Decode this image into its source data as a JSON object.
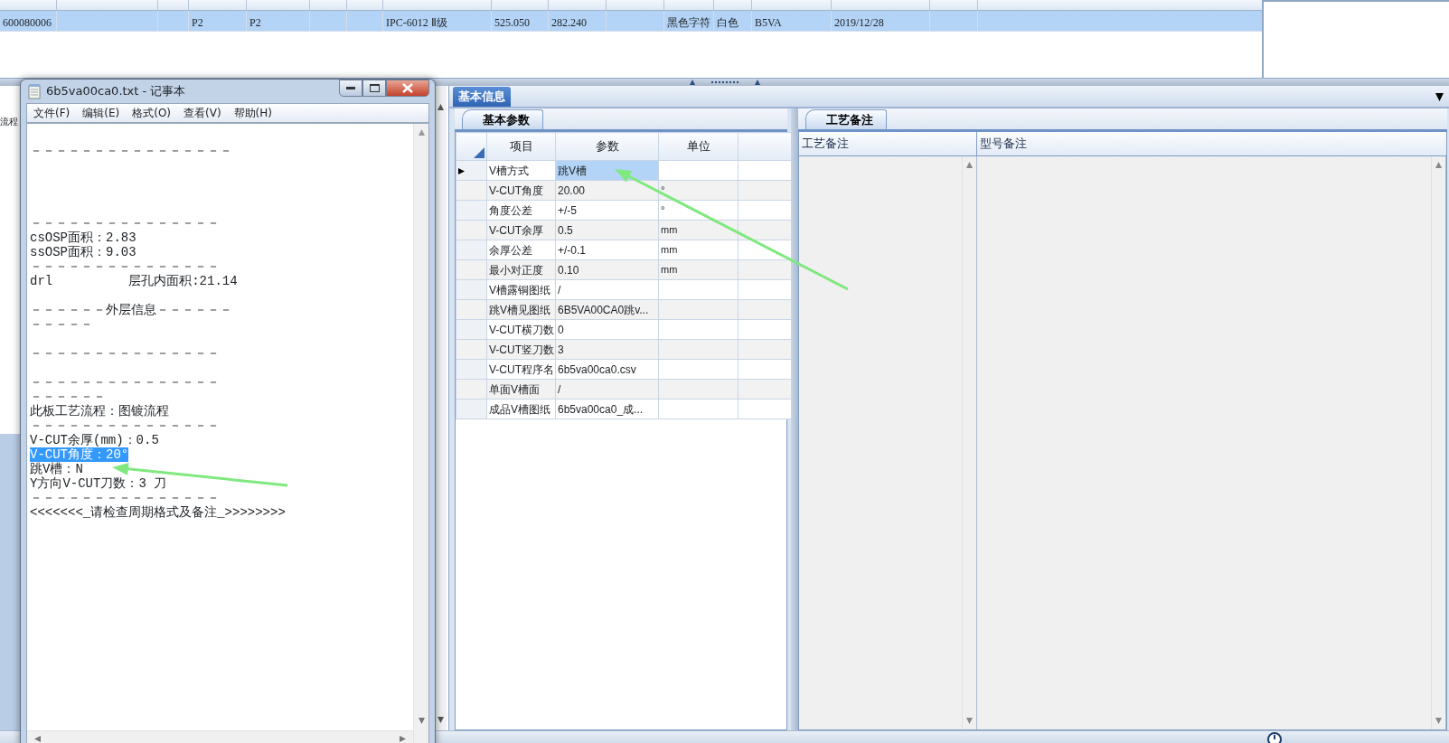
{
  "top_grid": {
    "rows": [
      {
        "selected": true,
        "cells": [
          {
            "text": "600080006"
          },
          {},
          {},
          {
            "text": "P2"
          },
          {
            "text": "P2"
          },
          {},
          {},
          {
            "text": "IPC-6012 Ⅱ级"
          },
          {
            "text": "525.050"
          },
          {
            "text": "282.240"
          },
          {},
          {
            "text": "黑色字符"
          },
          {
            "text": "白色"
          },
          {
            "text": "B5VA"
          },
          {
            "text": "2019/12/28"
          },
          {}
        ]
      }
    ]
  },
  "left_panel": {
    "label": "流程"
  },
  "notepad": {
    "title": "6b5va00ca0.txt - 记事本",
    "menu": [
      "文件(F)",
      "编辑(E)",
      "格式(O)",
      "查看(V)",
      "帮助(H)"
    ],
    "lines": [
      {
        "kind": "text",
        "text": "－－－－－－－－－－－－－－－－",
        "selected": false
      },
      {
        "kind": "blank"
      },
      {
        "kind": "blank"
      },
      {
        "kind": "blank"
      },
      {
        "kind": "blank"
      },
      {
        "kind": "text",
        "text": "－－－－－－－－－－－－－－－",
        "selected": false
      },
      {
        "kind": "text",
        "text": "csOSP面积：2.83",
        "selected": false
      },
      {
        "kind": "text",
        "text": "ssOSP面积：9.03",
        "selected": false
      },
      {
        "kind": "text",
        "text": "－－－－－－－－－－－－－－－",
        "selected": false
      },
      {
        "kind": "text",
        "text": "drl          层孔内面积:21.14",
        "selected": false
      },
      {
        "kind": "blank"
      },
      {
        "kind": "text",
        "text": "－－－－－－外层信息－－－－－－",
        "selected": false
      },
      {
        "kind": "text",
        "text": "－－－－－",
        "selected": false
      },
      {
        "kind": "blank"
      },
      {
        "kind": "text",
        "text": "－－－－－－－－－－－－－－－",
        "selected": false
      },
      {
        "kind": "blank"
      },
      {
        "kind": "text",
        "text": "－－－－－－－－－－－－－－－",
        "selected": false
      },
      {
        "kind": "text",
        "text": "－－－－－－",
        "selected": false
      },
      {
        "kind": "text",
        "text": "此板工艺流程：图镀流程",
        "selected": false
      },
      {
        "kind": "text",
        "text": "－－－－－－－－－－－－－－－",
        "selected": false
      },
      {
        "kind": "text",
        "text": "V-CUT余厚(mm)：0.5",
        "selected": false
      },
      {
        "kind": "text",
        "text": "V-CUT角度：20°",
        "selected": true
      },
      {
        "kind": "text",
        "text": "跳V槽：N",
        "selected": false
      },
      {
        "kind": "text",
        "text": "Y方向V-CUT刀数：3 刀",
        "selected": false
      },
      {
        "kind": "text",
        "text": "－－－－－－－－－－－－－－－",
        "selected": false
      },
      {
        "kind": "text",
        "text": "<<<<<<<_请检查周期格式及备注_>>>>>>>>",
        "selected": false
      }
    ]
  },
  "main_tabs": [
    {
      "label": "基本信息",
      "selected": true
    }
  ],
  "params_panel": {
    "tab": "基本参数",
    "columns": [
      "项目",
      "参数",
      "单位"
    ],
    "rows": [
      {
        "item": "V槽方式",
        "value": "跳V槽",
        "selected": true
      },
      {
        "item": "V-CUT角度",
        "value": "20.00",
        "unit": "°",
        "selected": false
      },
      {
        "item": "角度公差",
        "value": "+/-5",
        "unit": "°",
        "selected": false
      },
      {
        "item": "V-CUT余厚",
        "value": "0.5",
        "unit": "mm",
        "selected": false
      },
      {
        "item": "余厚公差",
        "value": "+/-0.1",
        "unit": "mm",
        "selected": false
      },
      {
        "item": "最小对正度",
        "value": "0.10",
        "unit": "mm",
        "selected": false
      },
      {
        "item": "V槽露铜图纸",
        "value": "/",
        "selected": false
      },
      {
        "item": "跳V槽见图纸",
        "value": "6B5VA00CA0跳v...",
        "selected": false
      },
      {
        "item": "V-CUT横刀数",
        "value": "0",
        "selected": false
      },
      {
        "item": "V-CUT竖刀数",
        "value": "3",
        "selected": false
      },
      {
        "item": "V-CUT程序名",
        "value": "6b5va00ca0.csv",
        "selected": false
      },
      {
        "item": "单面V槽面",
        "value": "/",
        "selected": false
      },
      {
        "item": "成品V槽图纸",
        "value": "6b5va00ca0_成...",
        "selected": false
      }
    ]
  },
  "remarks_panel": {
    "tab": "工艺备注",
    "columns": [
      "工艺备注",
      "型号备注"
    ]
  }
}
